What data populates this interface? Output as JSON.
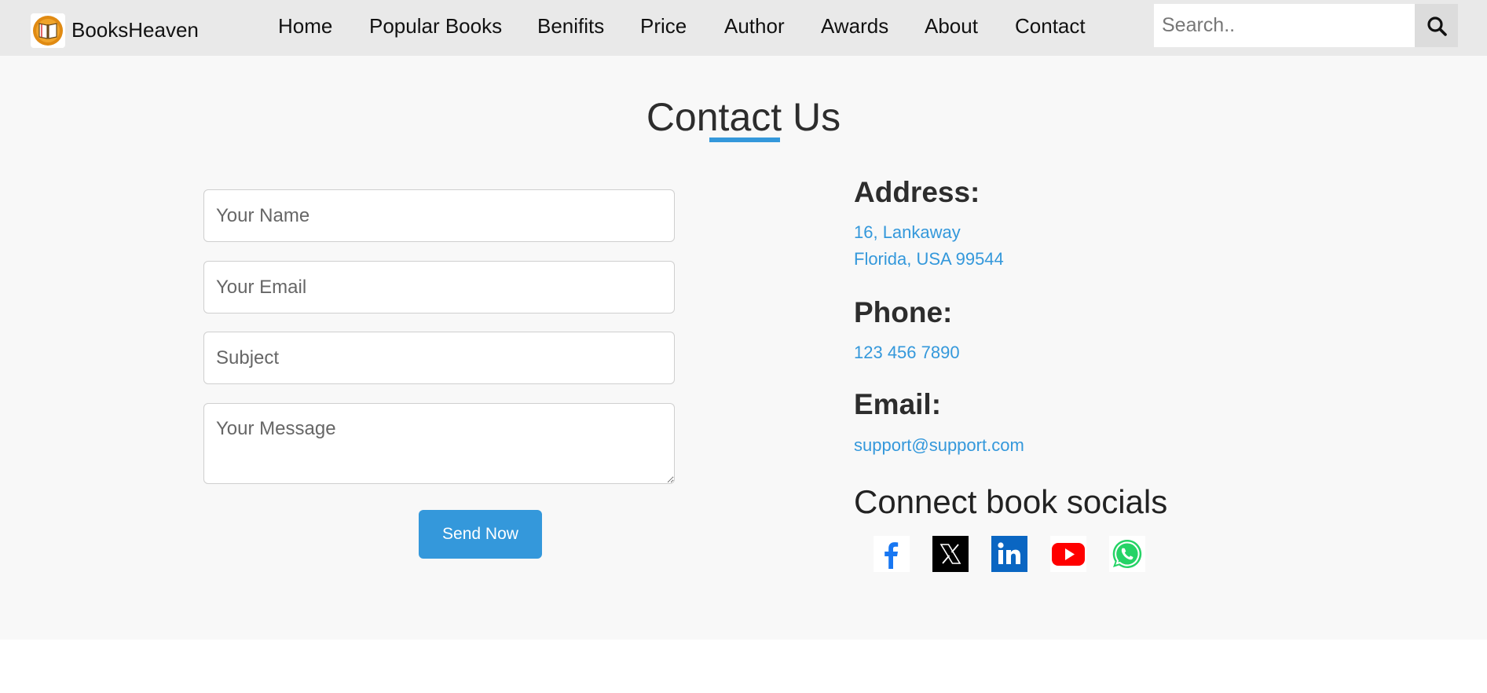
{
  "brand": {
    "name": "BooksHeaven",
    "logo_icon": "book-icon"
  },
  "nav": {
    "items": [
      {
        "label": "Home"
      },
      {
        "label": "Popular Books"
      },
      {
        "label": "Benifits"
      },
      {
        "label": "Price"
      },
      {
        "label": "Author"
      },
      {
        "label": "Awards"
      },
      {
        "label": "About"
      },
      {
        "label": "Contact"
      }
    ]
  },
  "search": {
    "placeholder": "Search..",
    "icon": "search-icon"
  },
  "contact": {
    "title": "Contact Us",
    "form": {
      "name_placeholder": "Your Name",
      "email_placeholder": "Your Email",
      "subject_placeholder": "Subject",
      "message_placeholder": "Your Message",
      "send_label": "Send Now"
    },
    "address": {
      "heading": "Address:",
      "line1": "16, Lankaway",
      "line2": "Florida, USA 99544"
    },
    "phone": {
      "heading": "Phone:",
      "value": "123 456 7890"
    },
    "email": {
      "heading": "Email:",
      "value": "support@support.com"
    },
    "socials": {
      "title": "Connect book socials",
      "icons": [
        "facebook-icon",
        "x-icon",
        "linkedin-icon",
        "youtube-icon",
        "whatsapp-icon"
      ]
    }
  },
  "colors": {
    "accent": "#3498db",
    "navbar_bg": "#e9e9e9",
    "section_bg": "#f8f8f8",
    "heading": "#2d2d2d"
  }
}
